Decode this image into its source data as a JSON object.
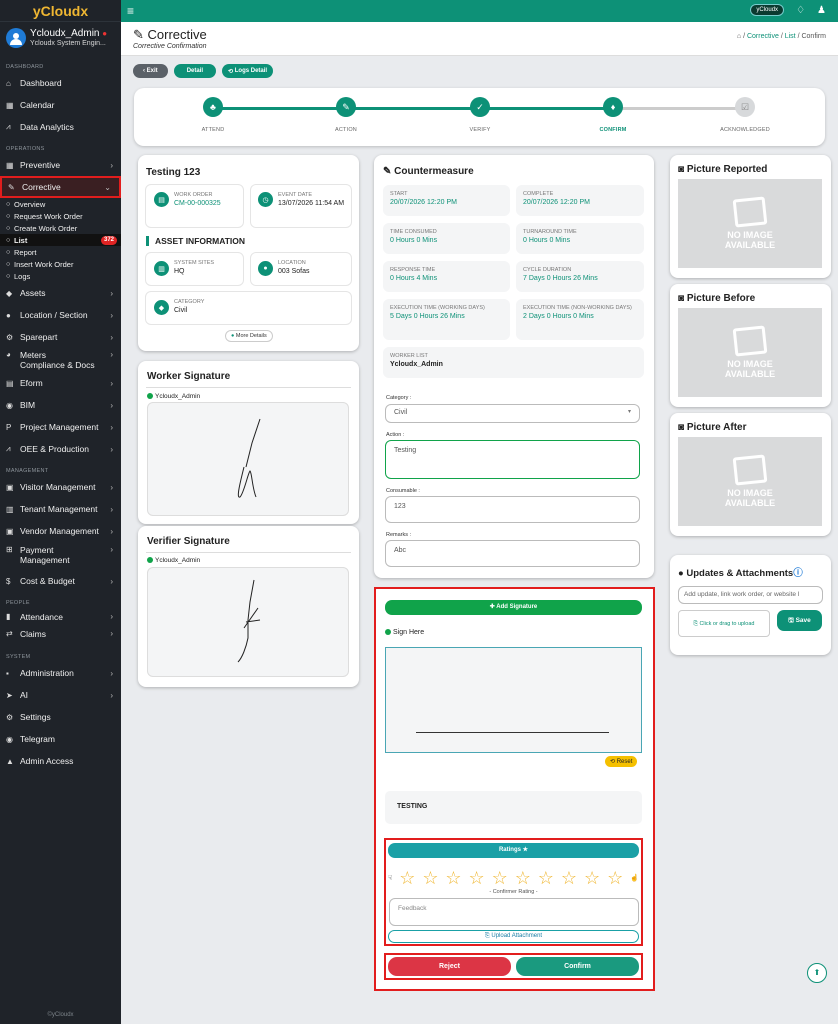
{
  "app": {
    "brand": "yCloudx",
    "user": "Ycloudx_Admin",
    "user_role": "Ycloudx System Engin...",
    "footer": "©yCloudx",
    "topbar_pill": "yCloudx"
  },
  "sidebar": {
    "sec_dashboard": "DASHBOARD",
    "sec_operations": "OPERATIONS",
    "sec_management": "MANAGEMENT",
    "sec_people": "PEOPLE",
    "sec_system": "SYSTEM",
    "dashboard": "Dashboard",
    "calendar": "Calendar",
    "analytics": "Data Analytics",
    "preventive": "Preventive",
    "corrective": "Corrective",
    "sub": [
      "Overview",
      "Request Work Order",
      "Create Work Order",
      "List",
      "Report",
      "Insert Work Order",
      "Logs"
    ],
    "list_badge": "372",
    "assets": "Assets",
    "location": "Location / Section",
    "sparepart": "Sparepart",
    "meters": "Meters",
    "compliance": "Compliance & Docs",
    "eform": "Eform",
    "bim": "BIM",
    "project": "Project Management",
    "oee": "OEE & Production",
    "visitor": "Visitor Management",
    "tenant": "Tenant Management",
    "vendor": "Vendor Management",
    "payment": "Payment Management",
    "cost": "Cost & Budget",
    "attendance": "Attendance",
    "claims": "Claims",
    "administration": "Administration",
    "ai": "AI",
    "settings": "Settings",
    "telegram": "Telegram",
    "admin_access": "Admin Access"
  },
  "header": {
    "title": "Corrective",
    "subtitle": "Corrective Confirmation",
    "bc1": "Corrective",
    "bc2": "List",
    "bc3": "Confirm"
  },
  "buttons": {
    "exit": "Exit",
    "detail": "Detail",
    "logs": "Logs Detail"
  },
  "steps": [
    "ATTEND",
    "ACTION",
    "VERIFY",
    "CONFIRM",
    "ACKNOWLEDGED"
  ],
  "wo": {
    "title": "Testing 123",
    "wo_label": "WORK ORDER",
    "wo_val": "CM-00-000325",
    "ev_label": "EVENT DATE",
    "ev_val": "13/07/2026 11:54 AM",
    "asset_h": "ASSET INFORMATION",
    "sys_label": "SYSTEM SITES",
    "sys_val": "HQ",
    "loc_label": "LOCATION",
    "loc_val": "003 Sofas",
    "cat_label": "CATEGORY",
    "cat_val": "Civil",
    "more": "More Details"
  },
  "worker_sig": {
    "title": "Worker Signature",
    "name": "Ycloudx_Admin"
  },
  "verifier_sig": {
    "title": "Verifier Signature",
    "name": "Ycloudx_Admin"
  },
  "cm": {
    "title": "Countermeasure",
    "start_l": "START",
    "start_v": "20/07/2026 12:20 PM",
    "comp_l": "COMPLETE",
    "comp_v": "20/07/2026 12:20 PM",
    "tc_l": "TIME CONSUMED",
    "tc_v": "0 Hours 0 Mins",
    "ta_l": "TURNAROUND TIME",
    "ta_v": "0 Hours 0 Mins",
    "rt_l": "RESPONSE TIME",
    "rt_v": "0 Hours 4 Mins",
    "cd_l": "CYCLE DURATION",
    "cd_v": "7 Days 0 Hours 26 Mins",
    "ew_l": "EXECUTION TIME (WORKING DAYS)",
    "ew_v": "5 Days 0 Hours 26 Mins",
    "en_l": "EXECUTION TIME (NON-WORKING DAYS)",
    "en_v": "2 Days 0 Hours 0 Mins",
    "wl_l": "WORKER LIST",
    "wl_v": "Ycloudx_Admin",
    "cat_l": "Category :",
    "cat_v": "Civil",
    "act_l": "Action :",
    "act_v": "Testing",
    "con_l": "Consumable :",
    "con_v": "123",
    "rem_l": "Remarks :",
    "rem_v": "Abc"
  },
  "confirm": {
    "add_sig": "Add Signature",
    "sign_here": "Sign Here",
    "reset": "Reset",
    "name": "TESTING",
    "ratings": "Ratings",
    "rating_cap": "- Confirmer Rating -",
    "feedback_ph": "Feedback",
    "upload": "Upload Attachment",
    "reject": "Reject",
    "confirm": "Confirm"
  },
  "pics": {
    "reported": "Picture Reported",
    "before": "Picture Before",
    "after": "Picture After",
    "noimg1": "NO IMAGE",
    "noimg2": "AVAILABLE"
  },
  "updates": {
    "title": "Updates & Attachments",
    "ph": "Add update, link work order, or website l",
    "upload": "Click or drag to upload",
    "save": "Save"
  }
}
